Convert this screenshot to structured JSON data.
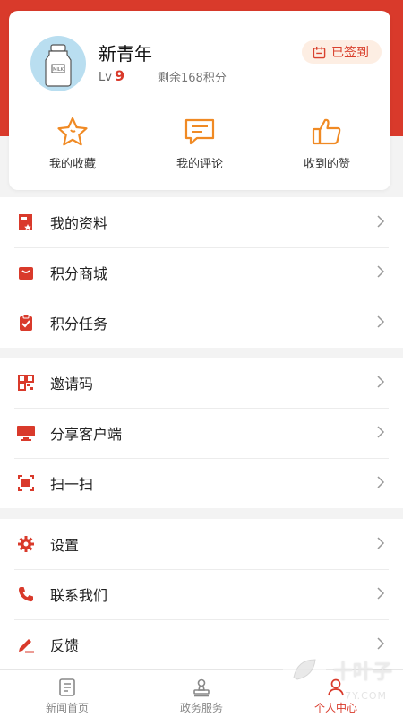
{
  "profile": {
    "username": "新青年",
    "level_prefix": "Lv",
    "level_value": "9",
    "points_text": "剩余168积分",
    "signin_label": "已签到"
  },
  "quick_actions": [
    {
      "label": "我的收藏",
      "icon": "star-icon"
    },
    {
      "label": "我的评论",
      "icon": "comment-icon"
    },
    {
      "label": "收到的赞",
      "icon": "thumbs-up-icon"
    }
  ],
  "menu_groups": [
    [
      {
        "label": "我的资料",
        "icon": "profile-doc-icon"
      },
      {
        "label": "积分商城",
        "icon": "shopping-bag-icon"
      },
      {
        "label": "积分任务",
        "icon": "task-clipboard-icon"
      }
    ],
    [
      {
        "label": "邀请码",
        "icon": "qr-code-icon"
      },
      {
        "label": "分享客户端",
        "icon": "monitor-icon"
      },
      {
        "label": "扫一扫",
        "icon": "scan-icon"
      }
    ],
    [
      {
        "label": "设置",
        "icon": "gear-icon"
      },
      {
        "label": "联系我们",
        "icon": "phone-icon"
      },
      {
        "label": "反馈",
        "icon": "edit-pen-icon"
      }
    ]
  ],
  "tabs": [
    {
      "label": "新闻首页",
      "icon": "news-icon",
      "active": false
    },
    {
      "label": "政务服务",
      "icon": "stamp-icon",
      "active": false
    },
    {
      "label": "个人中心",
      "icon": "person-icon",
      "active": true
    }
  ],
  "watermark": {
    "main": "十叶子",
    "sub": "7Y.COM"
  },
  "colors": {
    "accent": "#d93a2b",
    "icon_orange": "#f08a24",
    "background": "#f3f3f3"
  }
}
